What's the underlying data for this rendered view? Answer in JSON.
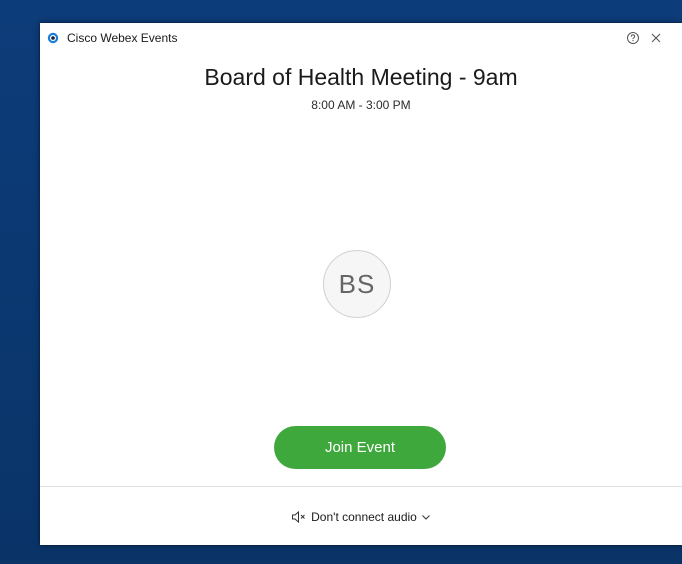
{
  "window": {
    "app_title": "Cisco Webex Events"
  },
  "event": {
    "title": "Board of Health Meeting - 9am",
    "time": "8:00 AM - 3:00 PM",
    "host_initials": "BS"
  },
  "actions": {
    "join_label": "Join Event"
  },
  "audio": {
    "selected_option": "Don't connect audio"
  },
  "colors": {
    "join_button": "#3fa83c",
    "backdrop": "#0b3873",
    "logo_ring": "#1a7ed8"
  },
  "icons": {
    "logo": "webex-logo-icon",
    "help": "help-circle-icon",
    "close": "close-icon",
    "audio": "speaker-muted-icon",
    "dropdown": "chevron-down-icon"
  }
}
